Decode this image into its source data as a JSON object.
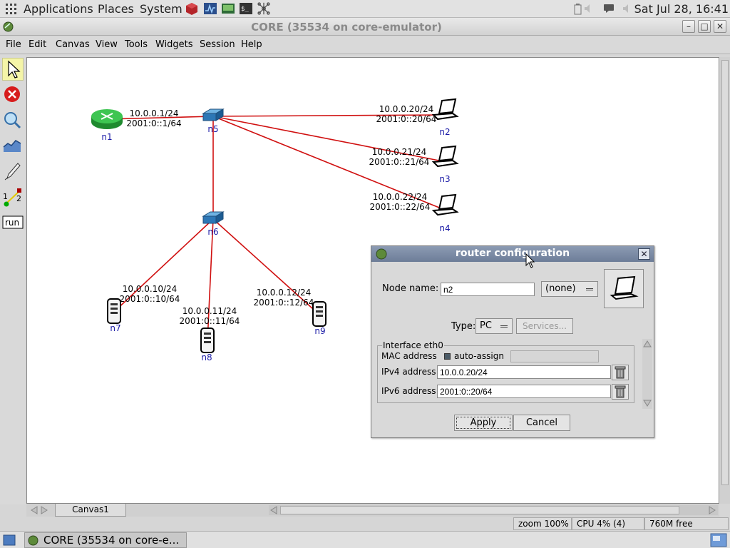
{
  "panel": {
    "applications": "Applications",
    "places": "Places",
    "system": "System",
    "clock": "Sat Jul 28, 16:41"
  },
  "window": {
    "title": "CORE (35534 on core-emulator)"
  },
  "menubar": {
    "file": "File",
    "edit": "Edit",
    "canvas": "Canvas",
    "view": "View",
    "tools": "Tools",
    "widgets": "Widgets",
    "session": "Session",
    "help": "Help"
  },
  "toolbar": {
    "run_label": "run",
    "link_a": "1",
    "link_b": "2"
  },
  "topology": {
    "nodes": [
      {
        "name": "n1",
        "kind": "router"
      },
      {
        "name": "n5",
        "kind": "switch"
      },
      {
        "name": "n6",
        "kind": "switch"
      },
      {
        "name": "n2",
        "kind": "pc"
      },
      {
        "name": "n3",
        "kind": "pc"
      },
      {
        "name": "n4",
        "kind": "pc"
      },
      {
        "name": "n7",
        "kind": "server"
      },
      {
        "name": "n8",
        "kind": "server"
      },
      {
        "name": "n9",
        "kind": "server"
      }
    ],
    "links": [
      {
        "from": "n1",
        "to": "n5",
        "ipv4": "10.0.0.1/24",
        "ipv6": "2001:0::1/64"
      },
      {
        "from": "n5",
        "to": "n2",
        "ipv4": "10.0.0.20/24",
        "ipv6": "2001:0::20/64"
      },
      {
        "from": "n5",
        "to": "n3",
        "ipv4": "10.0.0.21/24",
        "ipv6": "2001:0::21/64"
      },
      {
        "from": "n5",
        "to": "n4",
        "ipv4": "10.0.0.22/24",
        "ipv6": "2001:0::22/64"
      },
      {
        "from": "n5",
        "to": "n6",
        "ipv4": "",
        "ipv6": ""
      },
      {
        "from": "n6",
        "to": "n7",
        "ipv4": "10.0.0.10/24",
        "ipv6": "2001:0::10/64"
      },
      {
        "from": "n6",
        "to": "n8",
        "ipv4": "10.0.0.11/24",
        "ipv6": "2001:0::11/64"
      },
      {
        "from": "n6",
        "to": "n9",
        "ipv4": "10.0.0.12/24",
        "ipv6": "2001:0::12/64"
      }
    ],
    "link_color": "#d01010",
    "label_color": "#1a1aa6"
  },
  "tabs": {
    "canvas1": "Canvas1"
  },
  "status": {
    "zoom": "zoom 100%",
    "cpu": "CPU 4% (4)",
    "mem": "760M free"
  },
  "taskbar": {
    "core": "CORE (35534 on core-e..."
  },
  "dialog": {
    "title": "router configuration",
    "node_name_label": "Node name:",
    "node_name_value": "n2",
    "model_combo": "(none)",
    "type_label": "Type:",
    "type_value": "PC",
    "services_button": "Services...",
    "interface_legend": "Interface eth0",
    "mac_label": "MAC address",
    "mac_auto": "auto-assign",
    "mac_value": "",
    "ipv4_label": "IPv4 address",
    "ipv4_value": "10.0.0.20/24",
    "ipv6_label": "IPv6 address",
    "ipv6_value": "2001:0::20/64",
    "apply_button": "Apply",
    "cancel_button": "Cancel"
  }
}
